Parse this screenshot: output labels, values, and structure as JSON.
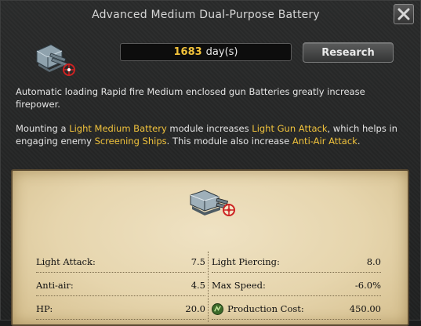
{
  "window": {
    "title": "Advanced Medium Dual-Purpose Battery"
  },
  "research": {
    "days_value": "1683",
    "days_unit": "day(s)",
    "button_label": "Research"
  },
  "description": {
    "p1": "Automatic loading Rapid fire Medium enclosed gun Batteries greatly increase firepower.",
    "p2": {
      "t1": "Mounting a ",
      "h1": "Light Medium Battery",
      "t2": " module increases ",
      "h2": "Light Gun Attack",
      "t3": ", which helps in engaging enemy ",
      "h3": "Screening Ships",
      "t4": ". This module also increase ",
      "h4": "Anti-Air Attack",
      "t5": "."
    }
  },
  "stats": {
    "rows": [
      {
        "left_label": "Light Attack:",
        "left_value": "7.5",
        "right_label": "Light Piercing:",
        "right_value": "8.0"
      },
      {
        "left_label": "Anti-air:",
        "left_value": "4.5",
        "right_label": "Max Speed:",
        "right_value": "-6.0%"
      },
      {
        "left_label": "HP:",
        "left_value": "20.0",
        "right_label": "Production Cost:",
        "right_value": "450.00"
      }
    ]
  },
  "colors": {
    "highlight": "#f0c23c",
    "days": "#f2c23a"
  }
}
